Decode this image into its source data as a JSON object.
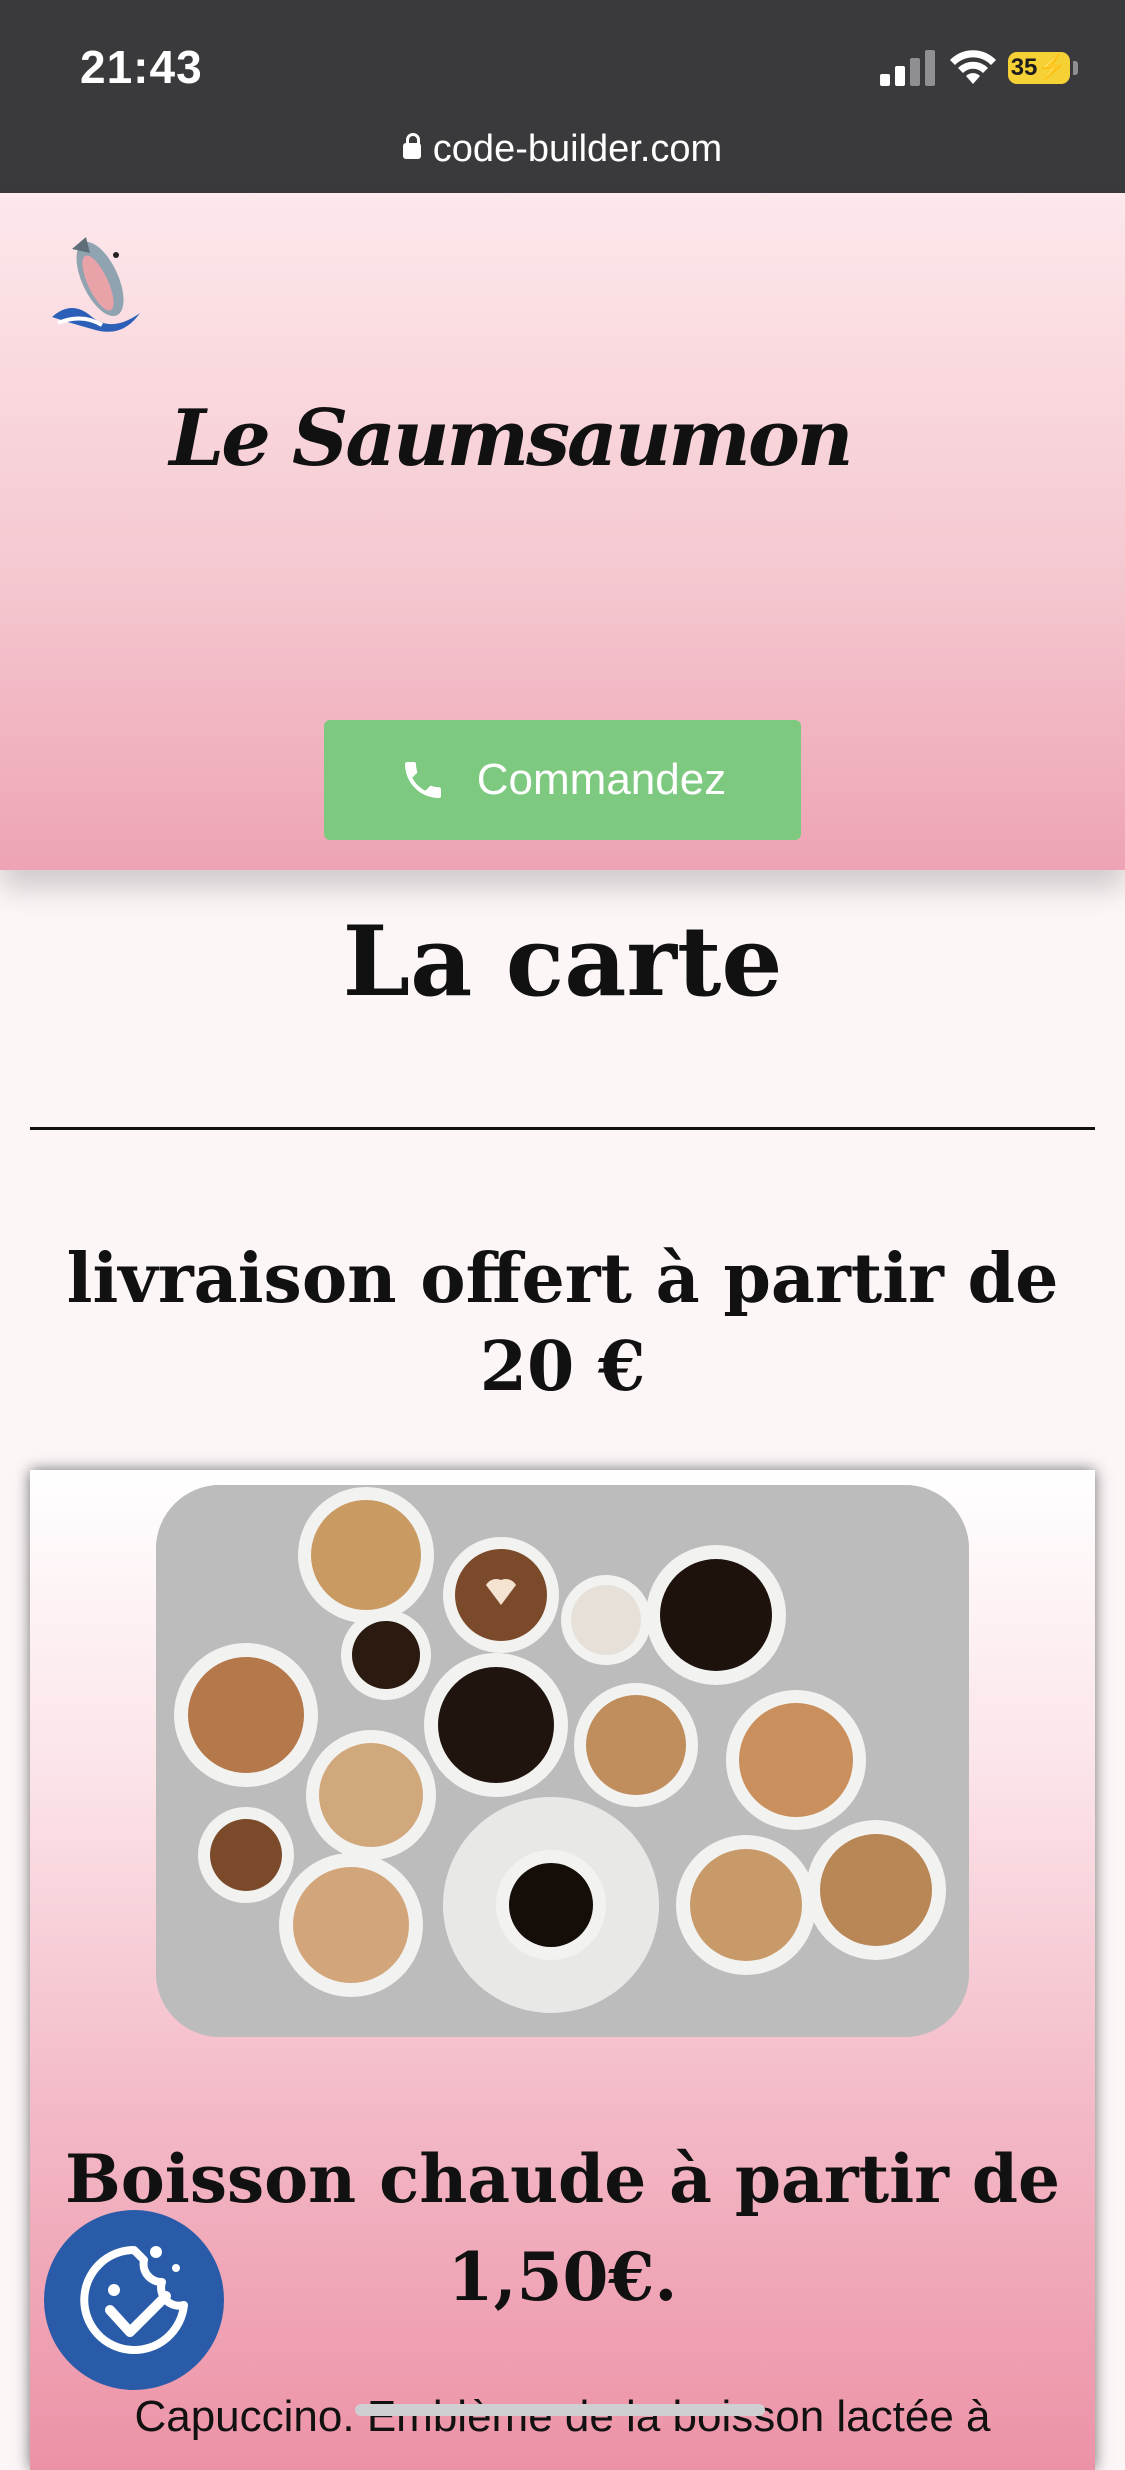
{
  "status_bar": {
    "time": "21:43",
    "battery": "35"
  },
  "browser": {
    "url": "code-builder.com"
  },
  "header": {
    "site_title": "Le Saumsaumon",
    "order_button_label": "Commandez"
  },
  "main": {
    "section_title": "La carte",
    "delivery_note": "livraison offert à partir de 20 €",
    "card": {
      "title": "Boisson chaude à partir de 1,50€.",
      "description": "Capuccino. Emblème de la boisson lactée à"
    }
  },
  "icons": {
    "lock": "lock-icon",
    "phone": "phone-icon",
    "consent": "cookie-consent-icon",
    "logo": "salmon-logo-icon"
  },
  "colors": {
    "status_bar": "#3a3a3c",
    "header_gradient_top": "#fde8eb",
    "header_gradient_bottom": "#eea3b4",
    "order_button": "#7dc97f",
    "consent_button": "#2a5ba8",
    "battery": "#f5d136"
  }
}
